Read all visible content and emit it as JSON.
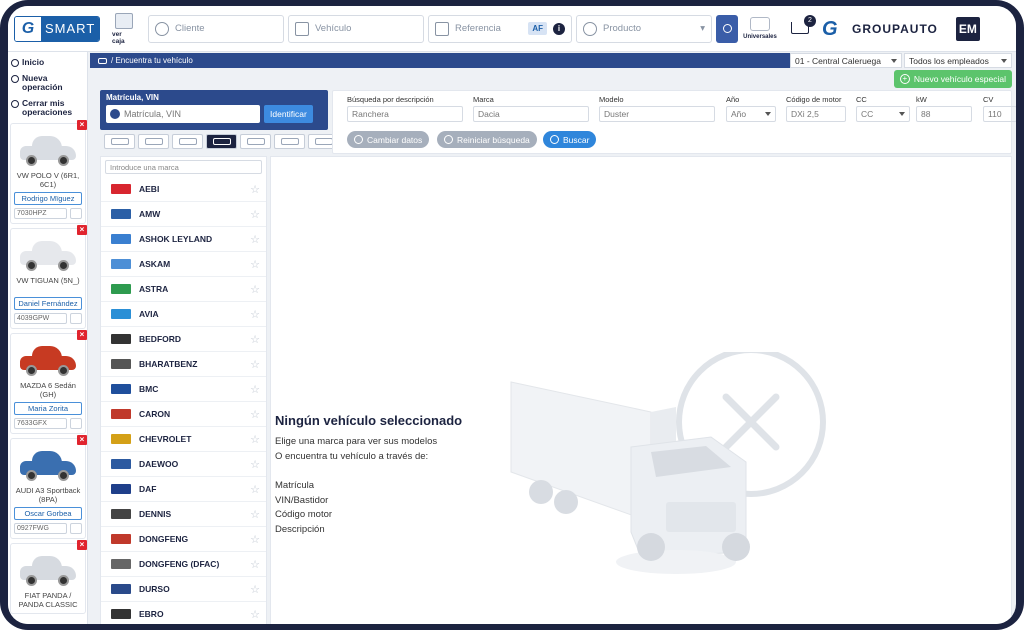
{
  "header": {
    "logo_text": "SMART",
    "logo_letter": "G",
    "caja_label": "ver caja",
    "cliente_placeholder": "Cliente",
    "vehiculo_placeholder": "Vehículo",
    "referencia_placeholder": "Referencia",
    "af_badge": "AF",
    "info_icon": "i",
    "producto_placeholder": "Producto",
    "universales_label": "Universales",
    "cart_count": "2",
    "brand_name": "GROUPAUTO",
    "brand_letter": "G",
    "user_initials": "EM"
  },
  "leftnav": {
    "items": [
      {
        "label": "Inicio",
        "icon": "home-icon"
      },
      {
        "label": "Nueva operación",
        "icon": "plus-icon"
      },
      {
        "label": "Cerrar mis operaciones",
        "icon": "close-icon"
      }
    ],
    "operations": [
      {
        "model": "VW POLO V (6R1, 6C1)",
        "user": "Rodrigo Mïguez",
        "plate": "7030HPZ",
        "color": "#d9dde3"
      },
      {
        "model": "VW TIGUAN (5N_)",
        "user": "Daniel Fernández",
        "plate": "4039GPW",
        "color": "#e6e8ec"
      },
      {
        "model": "MAZDA 6 Sedán (GH)",
        "user": "Maria Zorita",
        "plate": "7633GFX",
        "color": "#c73a22"
      },
      {
        "model": "AUDI A3 Sportback (8PA)",
        "user": "Oscar Gorbea",
        "plate": "0927FWG",
        "color": "#3a6fb0"
      },
      {
        "model": "FIAT PANDA / PANDA CLASSIC",
        "user": "",
        "plate": "",
        "color": "#d6dae0"
      }
    ]
  },
  "breadcrumb": {
    "text": "/ Encuentra tu vehículo",
    "warehouse": "01 - Central Caleruega",
    "employees": "Todos los empleados"
  },
  "new_vehicle_button": "Nuevo vehículo especial",
  "matricula": {
    "label": "Matrícula, VIN",
    "placeholder": "Matrícula, VIN",
    "identify_button": "Identificar"
  },
  "vehicle_types": [
    "car",
    "suv",
    "van",
    "bus",
    "truck",
    "tractor",
    "trailer"
  ],
  "descriptor": {
    "fields": [
      {
        "label": "Búsqueda por descripción",
        "value": "Ranchera"
      },
      {
        "label": "Marca",
        "value": "Dacia"
      },
      {
        "label": "Modelo",
        "value": "Duster"
      },
      {
        "label": "Año",
        "value": "Año"
      },
      {
        "label": "Código de motor",
        "value": "DXi 2,5"
      },
      {
        "label": "CC",
        "value": "CC"
      },
      {
        "label": "kW",
        "value": "88"
      },
      {
        "label": "CV",
        "value": "110"
      }
    ],
    "buttons": {
      "change": "Cambiar datos",
      "reset": "Reiniciar búsqueda",
      "search": "Buscar"
    }
  },
  "brands": {
    "search_placeholder": "Introduce una marca",
    "items": [
      {
        "name": "AEBI",
        "color": "#d8262f"
      },
      {
        "name": "AMW",
        "color": "#2b5fa6"
      },
      {
        "name": "ASHOK LEYLAND",
        "color": "#3a7fd0"
      },
      {
        "name": "ASKAM",
        "color": "#4d8fd6"
      },
      {
        "name": "ASTRA",
        "color": "#2e9b4f"
      },
      {
        "name": "AVIA",
        "color": "#2a8fd6"
      },
      {
        "name": "BEDFORD",
        "color": "#333333"
      },
      {
        "name": "BHARATBENZ",
        "color": "#555555"
      },
      {
        "name": "BMC",
        "color": "#1f4f9c"
      },
      {
        "name": "CARON",
        "color": "#c0392b"
      },
      {
        "name": "CHEVROLET",
        "color": "#d4a017"
      },
      {
        "name": "DAEWOO",
        "color": "#2c5aa0"
      },
      {
        "name": "DAF",
        "color": "#1f3f8a"
      },
      {
        "name": "DENNIS",
        "color": "#444444"
      },
      {
        "name": "DONGFENG",
        "color": "#c0392b"
      },
      {
        "name": "DONGFENG (DFAC)",
        "color": "#666666"
      },
      {
        "name": "DURSO",
        "color": "#2a4a8a"
      },
      {
        "name": "EBRO",
        "color": "#333333"
      }
    ]
  },
  "empty_state": {
    "title": "Ningún vehículo seleccionado",
    "line1": "Elige una marca para ver sus modelos",
    "line2": "O encuentra tu vehículo a través de:",
    "options": [
      "Matrícula",
      "VIN/Bastidor",
      "Código motor",
      "Descripción"
    ]
  }
}
